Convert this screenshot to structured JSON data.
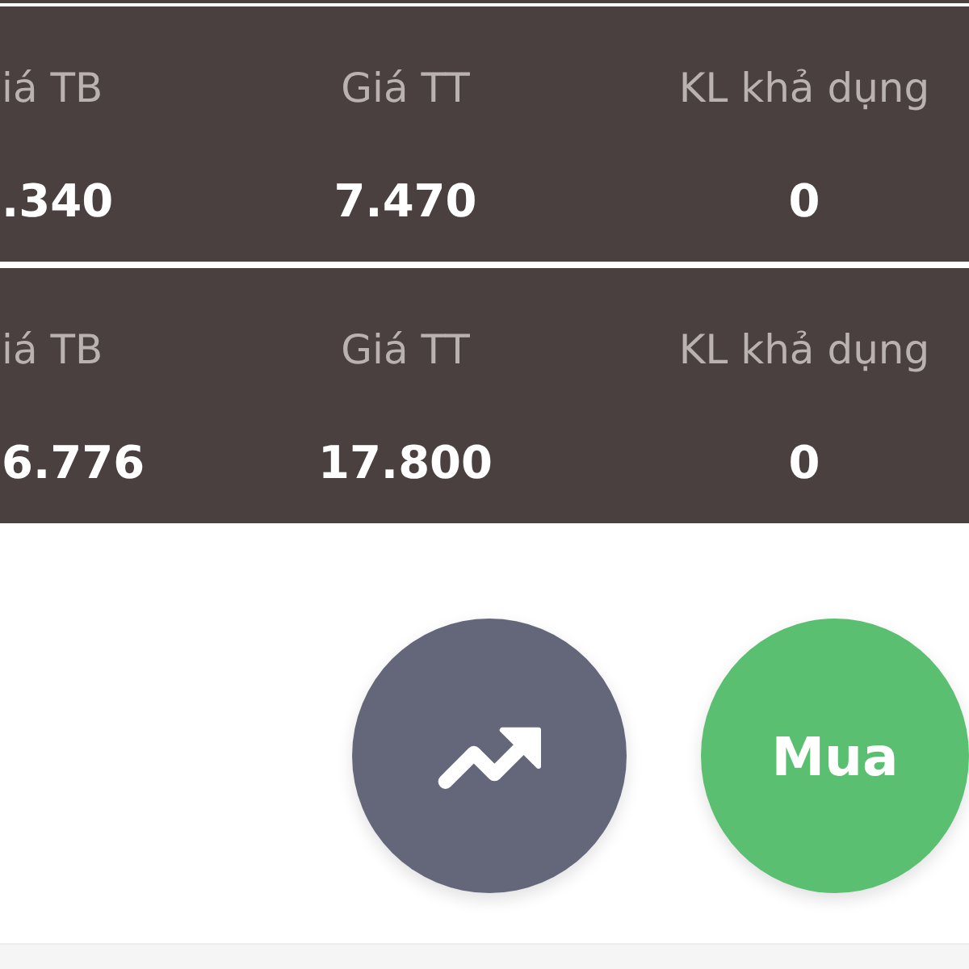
{
  "panels": [
    {
      "columns": [
        {
          "label": "iá TB",
          "value": ".340"
        },
        {
          "label": "Giá TT",
          "value": "7.470"
        },
        {
          "label": "KL khả dụng",
          "value": "0"
        }
      ]
    },
    {
      "columns": [
        {
          "label": "iá TB",
          "value": "6.776"
        },
        {
          "label": "Giá TT",
          "value": "17.800"
        },
        {
          "label": "KL khả dụng",
          "value": "0"
        }
      ]
    }
  ],
  "buttons": [
    {
      "kind": "trend"
    },
    {
      "kind": "label",
      "label": "Mua"
    }
  ]
}
